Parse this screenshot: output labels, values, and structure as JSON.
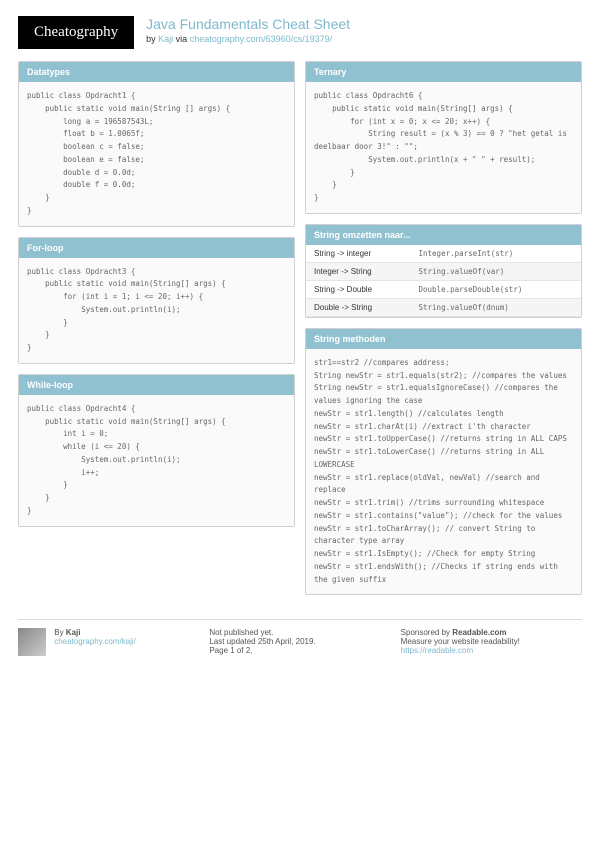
{
  "logo": "Cheatography",
  "title": "Java Fundamentals Cheat Sheet",
  "byline_by": "by ",
  "author": "Kaji",
  "byline_via": " via ",
  "url": "cheatography.com/63960/cs/19379/",
  "left": [
    {
      "head": "Datatypes",
      "body": "public class Opdracht1 {\n    public static void main(String [] args) {\n        long a = 196587543L;\n        float b = 1.0065f;\n        boolean c = false;\n        boolean e = false;\n        double d = 0.0d;\n        double f = 0.0d;\n    }\n}"
    },
    {
      "head": "For-loop",
      "body": "public class Opdracht3 {\n    public static void main(String[] args) {\n        for (int i = 1; i <= 20; i++) {\n            System.out.println(i);\n        }\n    }\n}"
    },
    {
      "head": "While-loop",
      "body": "public class Opdracht4 {\n    public static void main(String[] args) {\n        int i = 0;\n        while (i <= 20) {\n            System.out.println(i);\n            i++;\n        }\n    }\n}"
    }
  ],
  "ternary": {
    "head": "Ternary",
    "body": "public class Opdracht6 {\n    public static void main(String[] args) {\n        for (int x = 0; x <= 20; x++) {\n            String result = (x % 3) == 0 ? \"het getal is deelbaar door 3!\" : \"\";\n            System.out.println(x + \" \" + result);\n        }\n    }\n}"
  },
  "convert": {
    "head": "String omzetten naar...",
    "rows": [
      [
        "String -> integer",
        "Integer.parseInt(str)"
      ],
      [
        "Integer -> String",
        "String.valueOf(var)"
      ],
      [
        "String -> Double",
        "Double.parseDouble(str)"
      ],
      [
        "Double -> String",
        "String.valueOf(dnum)"
      ]
    ]
  },
  "methods": {
    "head": "String methoden",
    "body": "str1==str2 //compares address;\nString newStr = str1.equals(str2); //compares the values\nString newStr = str1.equalsIgnoreCase() //compares the values ignoring the case\nnewStr = str1.length() //calculates length\nnewStr = str1.charAt(i) //extract i'th character\nnewStr = str1.toUpperCase() //returns string in ALL CAPS\nnewStr = str1.toLowerCase() //returns string in ALL LOWERCASE\nnewStr = str1.replace(oldVal, newVal) //search and replace\nnewStr = str1.trim() //trims surrounding whitespace\nnewStr = str1.contains(\"value\"); //check for the values\nnewStr = str1.toCharArray(); // convert String to character type array\nnewStr = str1.IsEmpty(); //Check for empty String\nnewStr = str1.endsWith(); //Checks if string ends with the given suffix"
  },
  "footer": {
    "f1_by": "By ",
    "f1_author": "Kaji",
    "f1_link": "cheatography.com/kaji/",
    "f2_l1": "Not published yet.",
    "f2_l2": "Last updated 25th April, 2019.",
    "f2_l3": "Page 1 of 2.",
    "f3_l1": "Sponsored by ",
    "f3_bold": "Readable.com",
    "f3_l2": "Measure your website readability!",
    "f3_link": "https://readable.com"
  }
}
